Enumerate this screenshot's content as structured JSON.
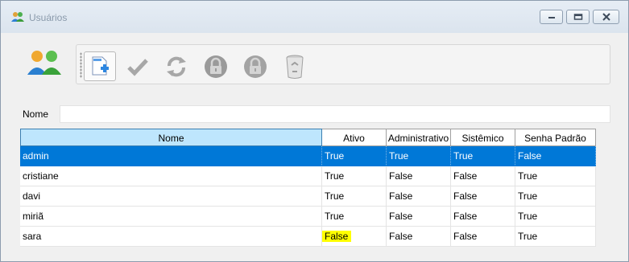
{
  "window": {
    "title": "Usuários"
  },
  "toolbar": {
    "buttons": [
      {
        "icon": "new-document-icon",
        "label": "Novo"
      },
      {
        "icon": "checkmark-icon",
        "label": "Salvar"
      },
      {
        "icon": "refresh-icon",
        "label": "Atualizar"
      },
      {
        "icon": "lock-icon",
        "label": "Bloquear"
      },
      {
        "icon": "lock-icon",
        "label": "Desbloquear"
      },
      {
        "icon": "recycle-bin-icon",
        "label": "Excluir"
      }
    ]
  },
  "filter": {
    "label": "Nome",
    "value": "",
    "placeholder": ""
  },
  "grid": {
    "columns": [
      "Nome",
      "Ativo",
      "Administrativo",
      "Sistêmico",
      "Senha Padrão"
    ],
    "rows": [
      [
        "admin",
        "True",
        "True",
        "True",
        "False"
      ],
      [
        "cristiane",
        "True",
        "False",
        "False",
        "True"
      ],
      [
        "davi",
        "True",
        "False",
        "False",
        "True"
      ],
      [
        "miriã",
        "True",
        "False",
        "False",
        "True"
      ],
      [
        "sara",
        "False",
        "False",
        "False",
        "True"
      ]
    ],
    "selected_row": 0,
    "highlighted_cell": {
      "row": 4,
      "col": 1,
      "color": "#ffff00"
    }
  },
  "colors": {
    "selection": "#0078d7",
    "header_active": "#bee6fd",
    "highlight": "#ffff00"
  }
}
